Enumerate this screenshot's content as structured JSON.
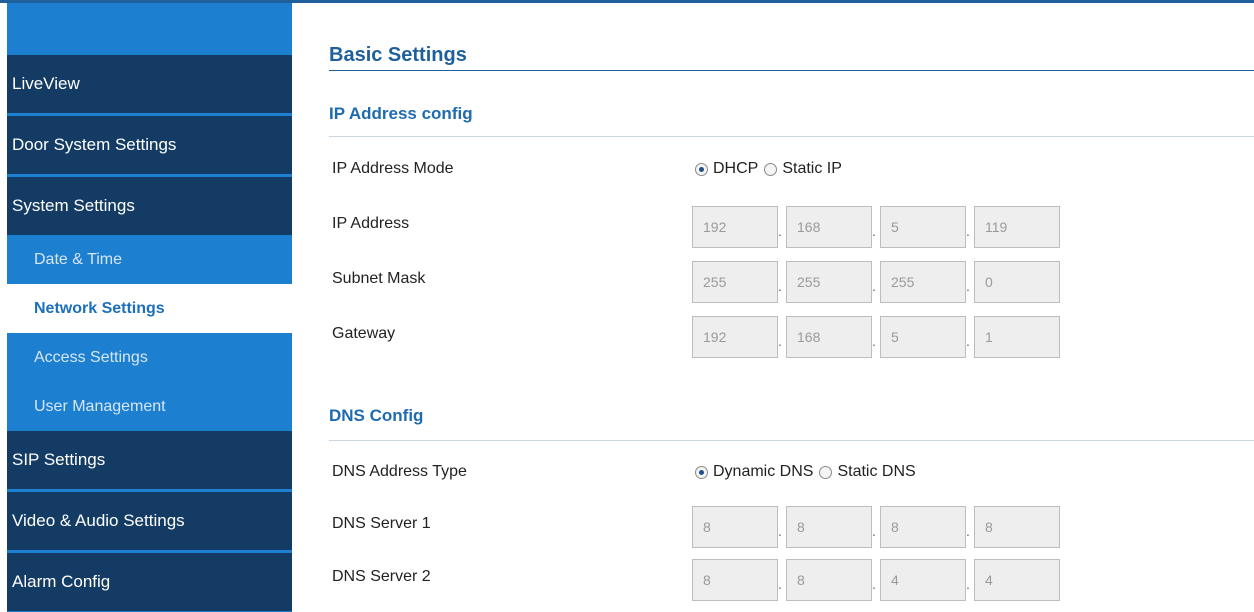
{
  "sidebar": {
    "items": [
      {
        "label": "LiveView",
        "type": "main"
      },
      {
        "label": "Door System Settings",
        "type": "main"
      },
      {
        "label": "System Settings",
        "type": "main"
      },
      {
        "label": "Date & Time",
        "type": "sub"
      },
      {
        "label": "Network Settings",
        "type": "sub",
        "active": true
      },
      {
        "label": "Access Settings",
        "type": "sub"
      },
      {
        "label": "User Management",
        "type": "sub"
      },
      {
        "label": "SIP Settings",
        "type": "main"
      },
      {
        "label": "Video & Audio Settings",
        "type": "main"
      },
      {
        "label": "Alarm Config",
        "type": "main"
      }
    ]
  },
  "main": {
    "title": "Basic Settings",
    "ip_section": {
      "title": "IP Address config",
      "mode": {
        "label": "IP Address Mode",
        "options": [
          "DHCP",
          "Static IP"
        ],
        "selected": "DHCP"
      },
      "ip_address": {
        "label": "IP Address",
        "octets": [
          "192",
          "168",
          "5",
          "119"
        ]
      },
      "subnet_mask": {
        "label": "Subnet Mask",
        "octets": [
          "255",
          "255",
          "255",
          "0"
        ]
      },
      "gateway": {
        "label": "Gateway",
        "octets": [
          "192",
          "168",
          "5",
          "1"
        ]
      }
    },
    "dns_section": {
      "title": "DNS Config",
      "type": {
        "label": "DNS Address Type",
        "options": [
          "Dynamic DNS",
          "Static DNS"
        ],
        "selected": "Dynamic DNS"
      },
      "server1": {
        "label": "DNS Server 1",
        "octets": [
          "8",
          "8",
          "8",
          "8"
        ]
      },
      "server2": {
        "label": "DNS Server 2",
        "octets": [
          "8",
          "8",
          "4",
          "4"
        ]
      }
    },
    "separator": "."
  },
  "colors": {
    "sidebar_dark": "#133b63",
    "sidebar_blue": "#1c7fcf",
    "heading_blue": "#1f5f9c",
    "active_text": "#1c6fba"
  }
}
